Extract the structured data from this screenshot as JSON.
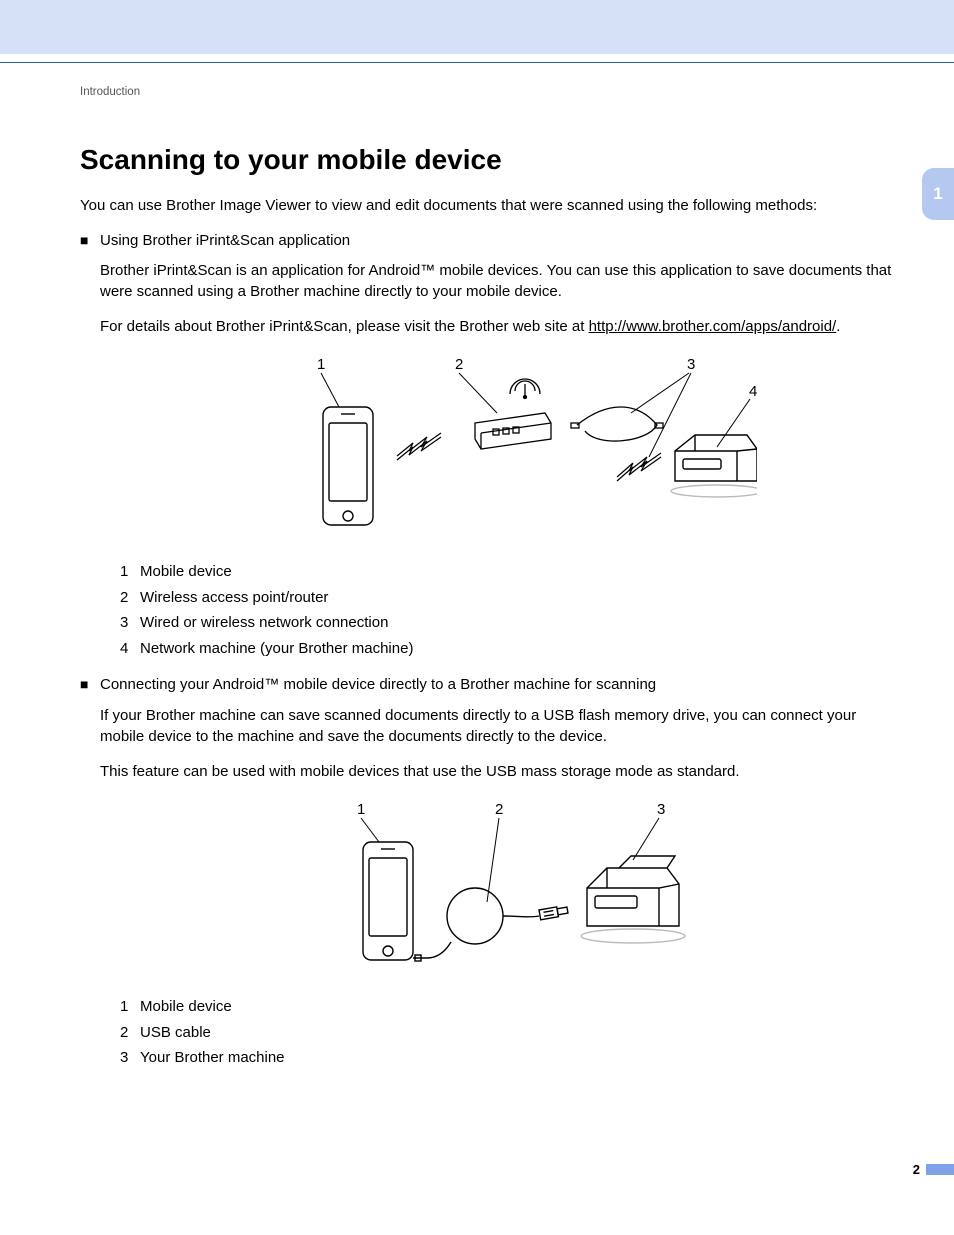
{
  "breadcrumb": "Introduction",
  "chapter_tab": "1",
  "page_number": "2",
  "heading": "Scanning to your mobile device",
  "intro": "You can use Brother Image Viewer to view and edit documents that were scanned using the following methods:",
  "bullets": [
    {
      "title": "Using Brother iPrint&Scan application",
      "paras": [
        "Brother iPrint&Scan is an application for Android™ mobile devices. You can use this application to save documents that were scanned using a Brother machine directly to your mobile device.",
        "For details about Brother iPrint&Scan, please visit the Brother web site at "
      ],
      "link_text": "http://www.brother.com/apps/android/",
      "link_suffix": ".",
      "figure": {
        "callouts": {
          "1": "1",
          "2": "2",
          "3": "3",
          "4": "4"
        }
      },
      "legend": [
        {
          "n": "1",
          "t": "Mobile device"
        },
        {
          "n": "2",
          "t": "Wireless access point/router"
        },
        {
          "n": "3",
          "t": "Wired or wireless network connection"
        },
        {
          "n": "4",
          "t": "Network machine (your Brother machine)"
        }
      ]
    },
    {
      "title": "Connecting your Android™ mobile device directly to a Brother machine for scanning",
      "paras": [
        "If your Brother machine can save scanned documents directly to a USB flash memory drive, you can connect your mobile device to the machine and save the documents directly to the device.",
        "This feature can be used with mobile devices that use the USB mass storage mode as standard."
      ],
      "figure": {
        "callouts": {
          "1": "1",
          "2": "2",
          "3": "3"
        }
      },
      "legend": [
        {
          "n": "1",
          "t": "Mobile device"
        },
        {
          "n": "2",
          "t": "USB cable"
        },
        {
          "n": "3",
          "t": "Your Brother machine"
        }
      ]
    }
  ]
}
